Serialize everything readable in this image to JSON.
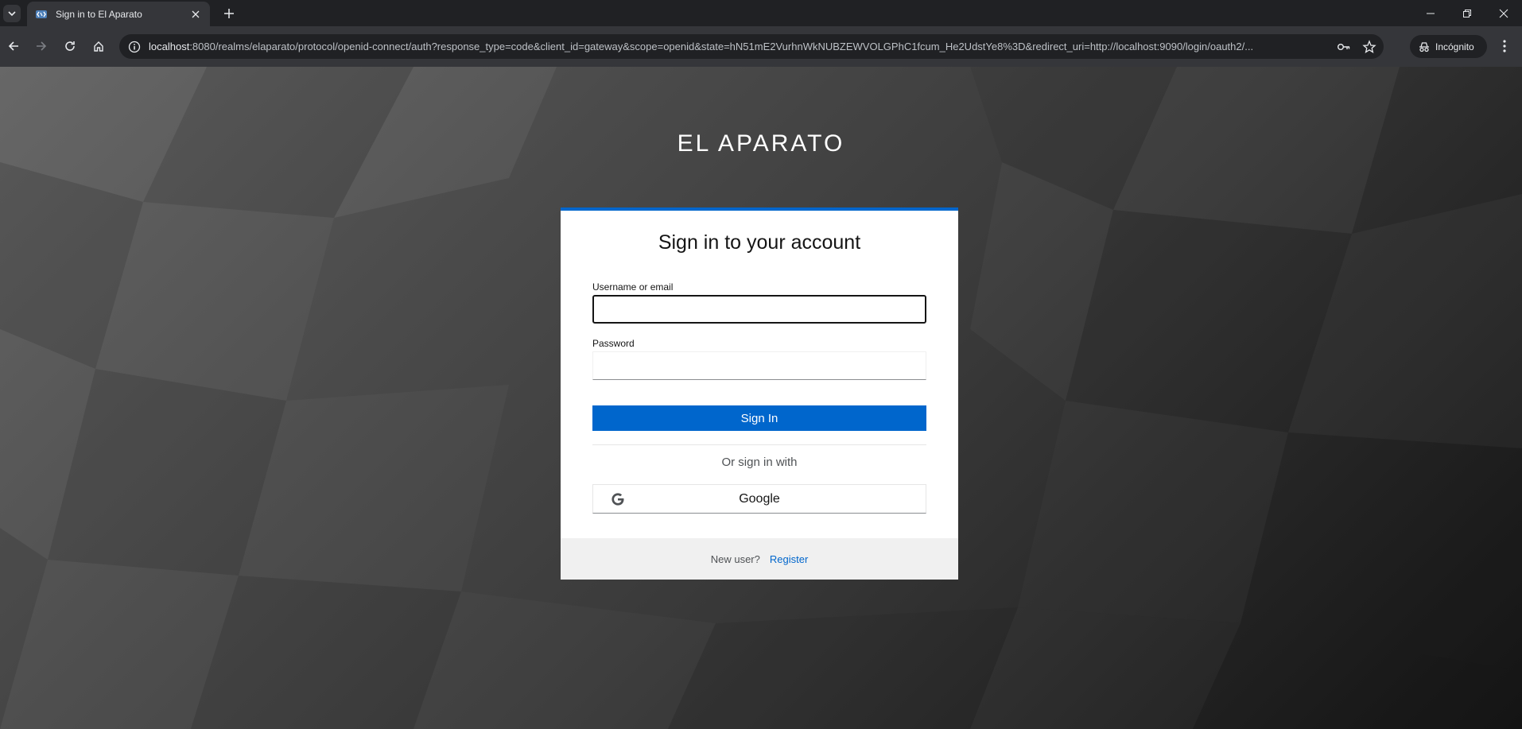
{
  "browser": {
    "tab": {
      "title": "Sign in to El Aparato"
    },
    "url": {
      "host": "localhost",
      "rest": ":8080/realms/elaparato/protocol/openid-connect/auth?response_type=code&client_id=gateway&scope=openid&state=hN51mE2VurhnWkNUBZEWVOLGPhC1fcum_He2UdstYe8%3D&redirect_uri=http://localhost:9090/login/oauth2/..."
    },
    "incognito_label": "Incógnito"
  },
  "page": {
    "brand": "EL APARATO",
    "title": "Sign in to your account",
    "username": {
      "label": "Username or email",
      "value": ""
    },
    "password": {
      "label": "Password",
      "value": ""
    },
    "signin_label": "Sign In",
    "or_text": "Or sign in with",
    "google_label": "Google",
    "footer": {
      "text": "New user?",
      "link": "Register"
    }
  },
  "colors": {
    "accent": "#0066cc",
    "chrome_dark": "#202124",
    "chrome_toolbar": "#35363a"
  }
}
